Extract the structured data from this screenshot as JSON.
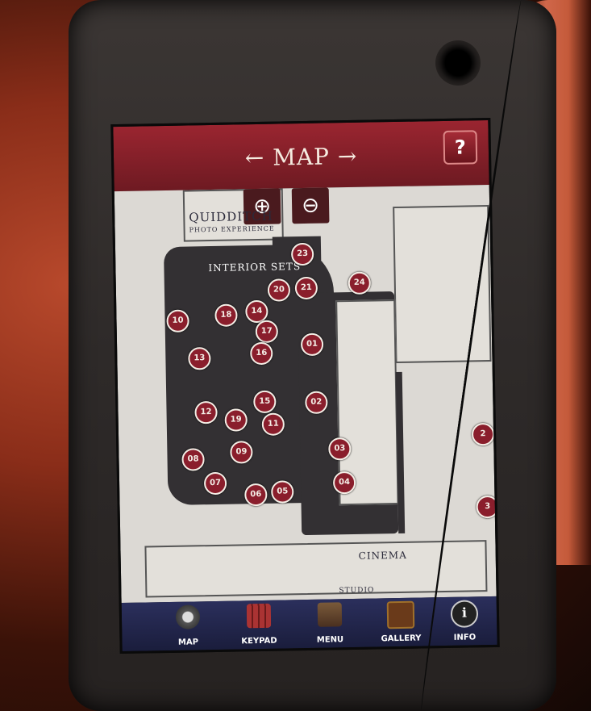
{
  "header": {
    "title": "← MAP →",
    "help_label": "?"
  },
  "zoom": {
    "in_label": "⊕",
    "out_label": "⊖"
  },
  "map_labels": {
    "quidditch": "Quidditch",
    "photo_experience": "Photo Experience",
    "interior_sets": "Interior Sets",
    "cinema": "Cinema",
    "studio": "Studio"
  },
  "pins": [
    "23",
    "20",
    "21",
    "24",
    "10",
    "18",
    "14",
    "17",
    "13",
    "16",
    "01",
    "15",
    "02",
    "12",
    "19",
    "11",
    "03",
    "08",
    "09",
    "07",
    "06",
    "05",
    "04",
    "2",
    "3"
  ],
  "tabs": [
    {
      "label": "MAP",
      "icon": "compass-icon"
    },
    {
      "label": "KEYPAD",
      "icon": "keypad-icon"
    },
    {
      "label": "MENU",
      "icon": "menu-icon"
    },
    {
      "label": "GALLERY",
      "icon": "gallery-icon"
    },
    {
      "label": "INFO",
      "icon": "info-icon"
    }
  ],
  "colors": {
    "header": "#8a1e2c",
    "pin": "#8a1e2c",
    "tabbar": "#22264a"
  }
}
